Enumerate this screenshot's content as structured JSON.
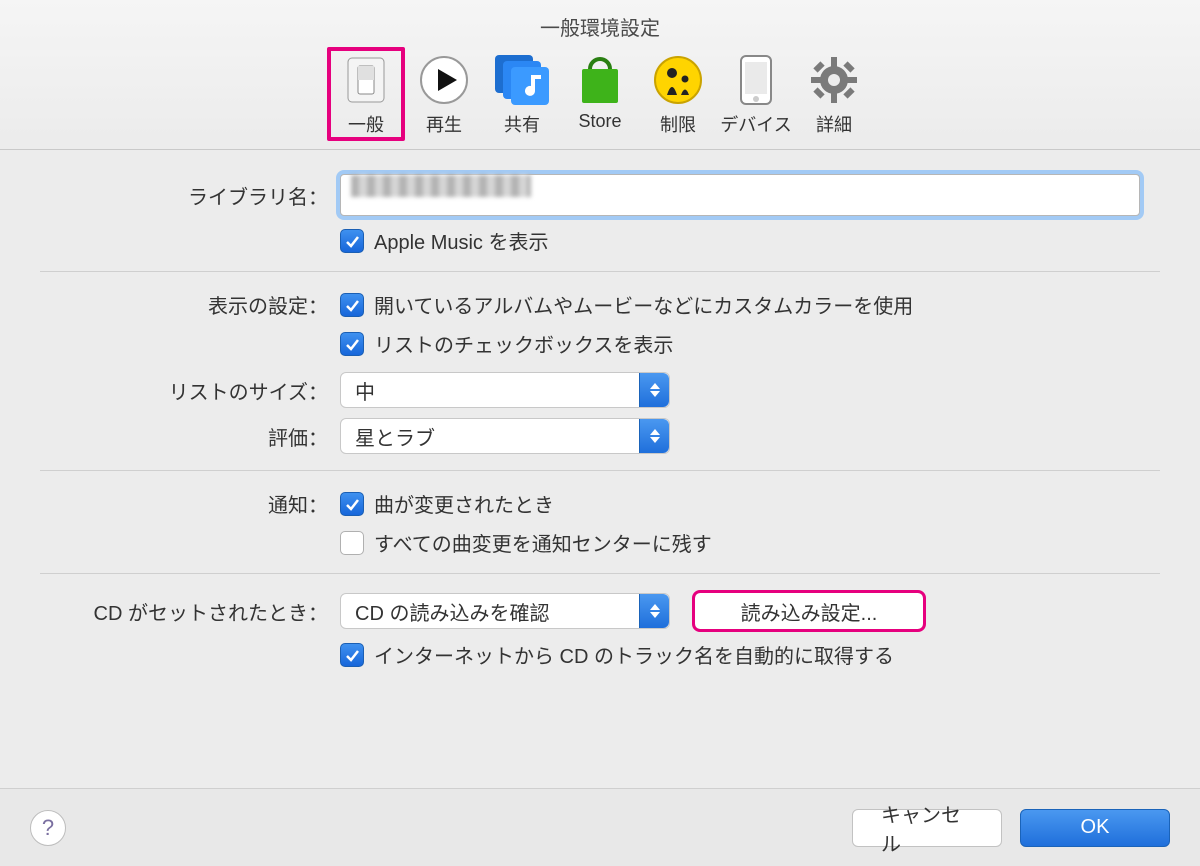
{
  "window_title": "一般環境設定",
  "toolbar": [
    {
      "label": "一般",
      "highlight": true
    },
    {
      "label": "再生"
    },
    {
      "label": "共有"
    },
    {
      "label": "Store"
    },
    {
      "label": "制限"
    },
    {
      "label": "デバイス"
    },
    {
      "label": "詳細"
    }
  ],
  "library_name": {
    "label": "ライブラリ名：",
    "value_redacted": true
  },
  "show_apple_music": {
    "checked": true,
    "label": "Apple Music を表示"
  },
  "display_settings": {
    "label": "表示の設定：",
    "custom_color": {
      "checked": true,
      "label": "開いているアルバムやムービーなどにカスタムカラーを使用"
    },
    "list_checkbox": {
      "checked": true,
      "label": "リストのチェックボックスを表示"
    }
  },
  "list_size": {
    "label": "リストのサイズ：",
    "value": "中"
  },
  "rating": {
    "label": "評価：",
    "value": "星とラブ"
  },
  "notifications": {
    "label": "通知：",
    "on_song_change": {
      "checked": true,
      "label": "曲が変更されたとき"
    },
    "leave_in_center": {
      "checked": false,
      "label": "すべての曲変更を通知センターに残す"
    }
  },
  "cd": {
    "label": "CD がセットされたとき：",
    "select_value": "CD の読み込みを確認",
    "import_settings_button": "読み込み設定...",
    "auto_track_names": {
      "checked": true,
      "label": "インターネットから CD のトラック名を自動的に取得する"
    }
  },
  "footer": {
    "cancel": "キャンセル",
    "ok": "OK"
  }
}
